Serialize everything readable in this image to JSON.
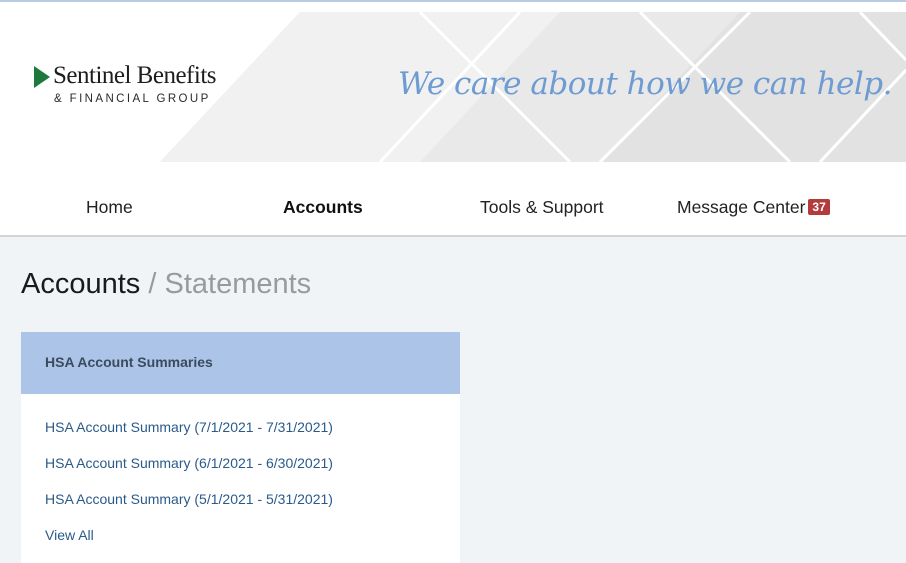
{
  "brand": {
    "name": "Sentinel Benefits",
    "subtitle": "& FINANCIAL GROUP",
    "tagline": "We care about how we can help.",
    "accent_color": "#1e7a3c",
    "tagline_color": "#6e9bd2"
  },
  "nav": {
    "home": "Home",
    "accounts": "Accounts",
    "tools": "Tools & Support",
    "messages": "Message Center",
    "messages_count": "37",
    "active": "accounts"
  },
  "page": {
    "title": "Accounts",
    "separator": "/",
    "subtitle": "Statements"
  },
  "card": {
    "title": "HSA Account Summaries",
    "items": [
      {
        "label": "HSA Account Summary (7/1/2021 - 7/31/2021)"
      },
      {
        "label": "HSA Account Summary (6/1/2021 - 6/30/2021)"
      },
      {
        "label": "HSA Account Summary (5/1/2021 - 5/31/2021)"
      }
    ],
    "view_all": "View All"
  }
}
